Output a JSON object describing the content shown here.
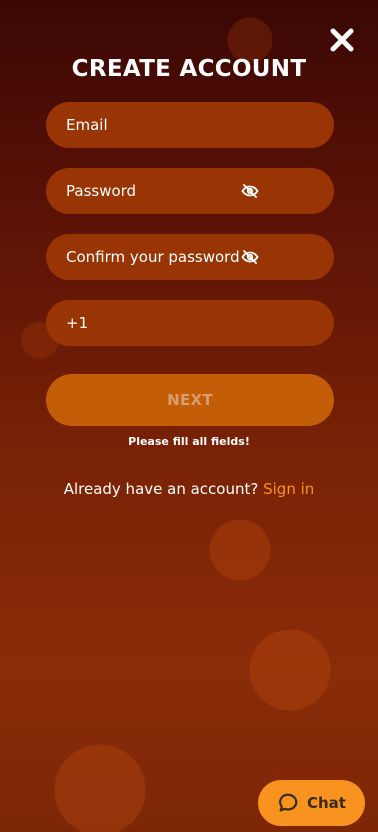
{
  "header": {
    "title": "CREATE ACCOUNT",
    "close_icon": "close-icon"
  },
  "form": {
    "email_placeholder": "Email",
    "password_placeholder": "Password",
    "confirm_placeholder": "Confirm your password",
    "phone_prefix": "+1",
    "eye_icon": "eye-off-icon",
    "next_label": "NEXT",
    "hint": "Please fill all fields!"
  },
  "signin": {
    "prompt": "Already have an account?",
    "link": "Sign in"
  },
  "chat": {
    "label": "Chat",
    "icon": "chat-bubble-icon"
  },
  "colors": {
    "field_bg": "#993504",
    "button_bg": "#c45d08",
    "accent": "#f7931e"
  }
}
